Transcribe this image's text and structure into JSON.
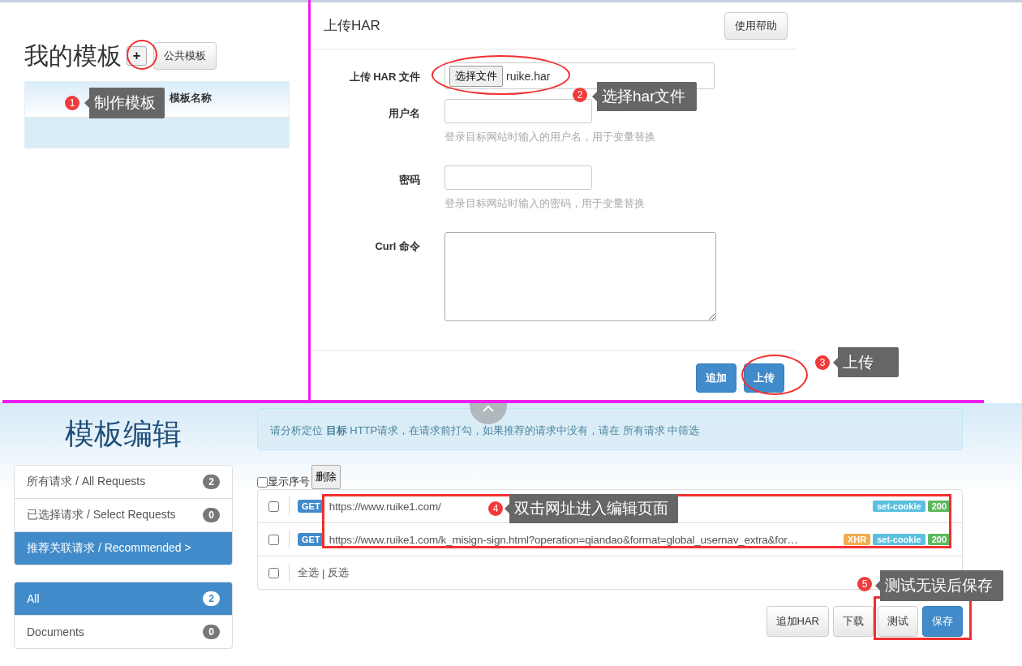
{
  "my_templates": {
    "title": "我的模板",
    "add_button": "+",
    "public_button": "公共模板",
    "table": {
      "columns": [
        "模板名称"
      ]
    }
  },
  "upload_dialog": {
    "title": "上传HAR",
    "help_button": "使用帮助",
    "fields": [
      {
        "kind": "file",
        "label": "上传 HAR 文件",
        "button": "选择文件",
        "value": "ruike.har"
      },
      {
        "kind": "text",
        "label": "用户名",
        "help": "登录目标网站时输入的用户名，用于变量替换"
      },
      {
        "kind": "text",
        "label": "密码",
        "help": "登录目标网站时输入的密码，用于变量替换"
      },
      {
        "kind": "textarea",
        "label": "Curl 命令"
      }
    ],
    "buttons": [
      "追加",
      "上传"
    ]
  },
  "template_editor": {
    "title": "模板编辑",
    "request_filters": [
      {
        "label": "所有请求 / All Requests",
        "count": "2",
        "selected": false
      },
      {
        "label": "已选择请求 / Select Requests",
        "count": "0",
        "selected": false
      },
      {
        "label": "推荐关联请求 / Recommended >",
        "selected": true
      }
    ],
    "type_filters": [
      {
        "label": "All",
        "count": "2",
        "selected": true
      },
      {
        "label": "Documents",
        "count": "0",
        "selected": false
      }
    ],
    "notice": "请分析定位 **目标** HTTP请求，在请求前打勾，如果推荐的请求中没有，请在 所有请求 中筛选",
    "show_index": {
      "label": "显示序号",
      "checked": false
    },
    "delete_button": "删除",
    "requests": [
      {
        "checked": false,
        "method": "GET",
        "url": "https://www.ruike1.com/",
        "tags": [
          {
            "text": "set-cookie",
            "color": "#5bc0de"
          },
          {
            "text": "200",
            "color": "#5cb85c"
          }
        ]
      },
      {
        "checked": false,
        "method": "GET",
        "url": "https://www.ruike1.com/k_misign-sign.html?operation=qiandao&format=global_usernav_extra&for…",
        "tags": [
          {
            "text": "XHR",
            "color": "#f0ad4e"
          },
          {
            "text": "set-cookie",
            "color": "#5bc0de"
          },
          {
            "text": "200",
            "color": "#5cb85c"
          }
        ]
      }
    ],
    "select_all": {
      "checked": false,
      "select": "全选",
      "separator": "|",
      "invert": "反选"
    },
    "buttons": [
      {
        "label": "追加HAR",
        "kind": "default"
      },
      {
        "label": "下载",
        "kind": "default"
      },
      {
        "label": "测试",
        "kind": "default"
      },
      {
        "label": "保存",
        "kind": "primary"
      }
    ]
  },
  "annotations": [
    {
      "number": "1",
      "text": "制作模板",
      "kind": "ellipse"
    },
    {
      "number": "2",
      "text": "选择har文件",
      "kind": "ellipse"
    },
    {
      "number": "3",
      "text": "上传",
      "kind": "ellipse"
    },
    {
      "number": "4",
      "text": "双击网址进入编辑页面",
      "kind": "rectangle"
    },
    {
      "number": "5",
      "text": "测试无误后保存",
      "kind": "rectangle"
    }
  ]
}
